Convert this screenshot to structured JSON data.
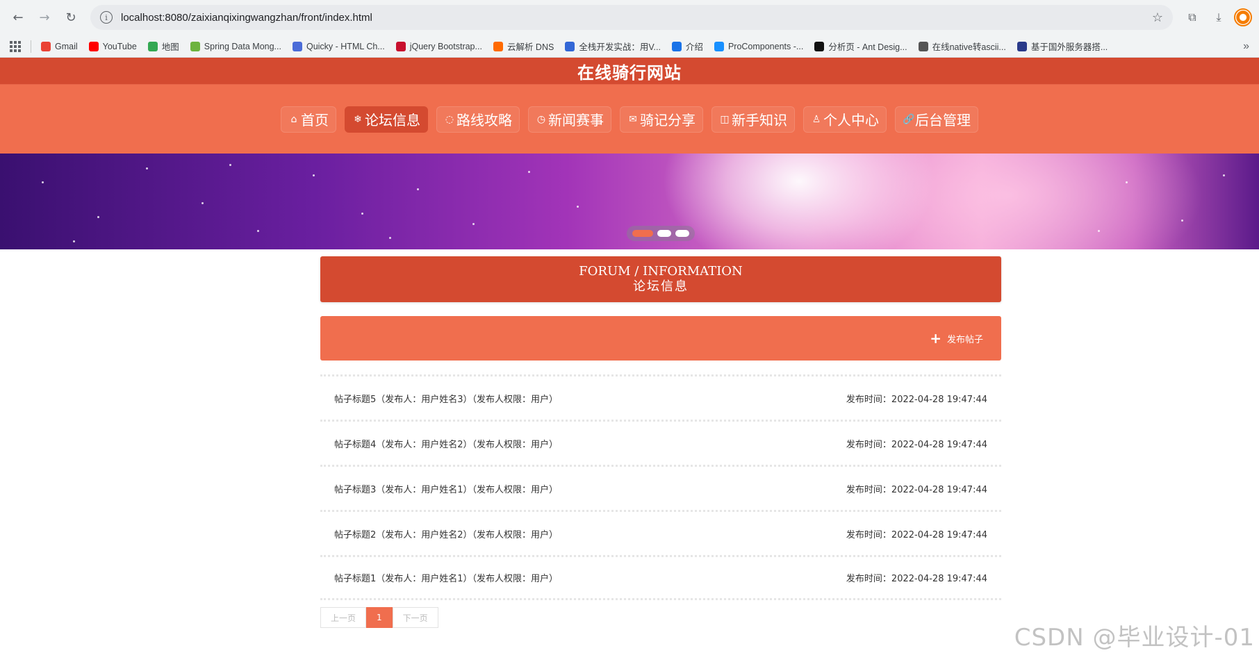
{
  "browser": {
    "url": "localhost:8080/zaixianqixingwangzhan/front/index.html",
    "bookmarks": [
      {
        "label": "Gmail",
        "color": "#ea4335"
      },
      {
        "label": "YouTube",
        "color": "#ff0000"
      },
      {
        "label": "地图",
        "color": "#34a853"
      },
      {
        "label": "Spring Data Mong...",
        "color": "#6db33f"
      },
      {
        "label": "Quicky - HTML Ch...",
        "color": "#4b6cd8"
      },
      {
        "label": "jQuery Bootstrap...",
        "color": "#c8102e"
      },
      {
        "label": "云解析 DNS",
        "color": "#ff6a00"
      },
      {
        "label": "全栈开发实战：用V...",
        "color": "#3367d6"
      },
      {
        "label": "介绍",
        "color": "#1a73e8"
      },
      {
        "label": "ProComponents -...",
        "color": "#1890ff"
      },
      {
        "label": "分析页 - Ant Desig...",
        "color": "#111111"
      },
      {
        "label": "在线native转ascii...",
        "color": "#555555"
      },
      {
        "label": "基于国外服务器搭...",
        "color": "#2a3a8a"
      }
    ]
  },
  "site": {
    "title": "在线骑行网站",
    "nav": [
      {
        "icon": "⌂",
        "label": "首页",
        "active": false
      },
      {
        "icon": "❄",
        "label": "论坛信息",
        "active": true
      },
      {
        "icon": "◌",
        "label": "路线攻略",
        "active": false
      },
      {
        "icon": "◷",
        "label": "新闻赛事",
        "active": false
      },
      {
        "icon": "✉",
        "label": "骑记分享",
        "active": false
      },
      {
        "icon": "◫",
        "label": "新手知识",
        "active": false
      },
      {
        "icon": "♙",
        "label": "个人中心",
        "active": false
      },
      {
        "icon": "🔗",
        "label": "后台管理",
        "active": false
      }
    ],
    "accent": "#d44a30",
    "accent_light": "#f06e4e"
  },
  "section": {
    "title_en": "FORUM / INFORMATION",
    "title_cn": "论坛信息",
    "publish_label": "发布帖子"
  },
  "posts": [
    {
      "title": "帖子标题5（发布人：用户姓名3）（发布人权限：用户）",
      "time": "发布时间：2022-04-28 19:47:44"
    },
    {
      "title": "帖子标题4（发布人：用户姓名2）（发布人权限：用户）",
      "time": "发布时间：2022-04-28 19:47:44"
    },
    {
      "title": "帖子标题3（发布人：用户姓名1）（发布人权限：用户）",
      "time": "发布时间：2022-04-28 19:47:44"
    },
    {
      "title": "帖子标题2（发布人：用户姓名2）（发布人权限：用户）",
      "time": "发布时间：2022-04-28 19:47:44"
    },
    {
      "title": "帖子标题1（发布人：用户姓名1）（发布人权限：用户）",
      "time": "发布时间：2022-04-28 19:47:44"
    }
  ],
  "pager": {
    "prev": "上一页",
    "current": "1",
    "next": "下一页"
  },
  "watermark": "CSDN @毕业设计-01"
}
